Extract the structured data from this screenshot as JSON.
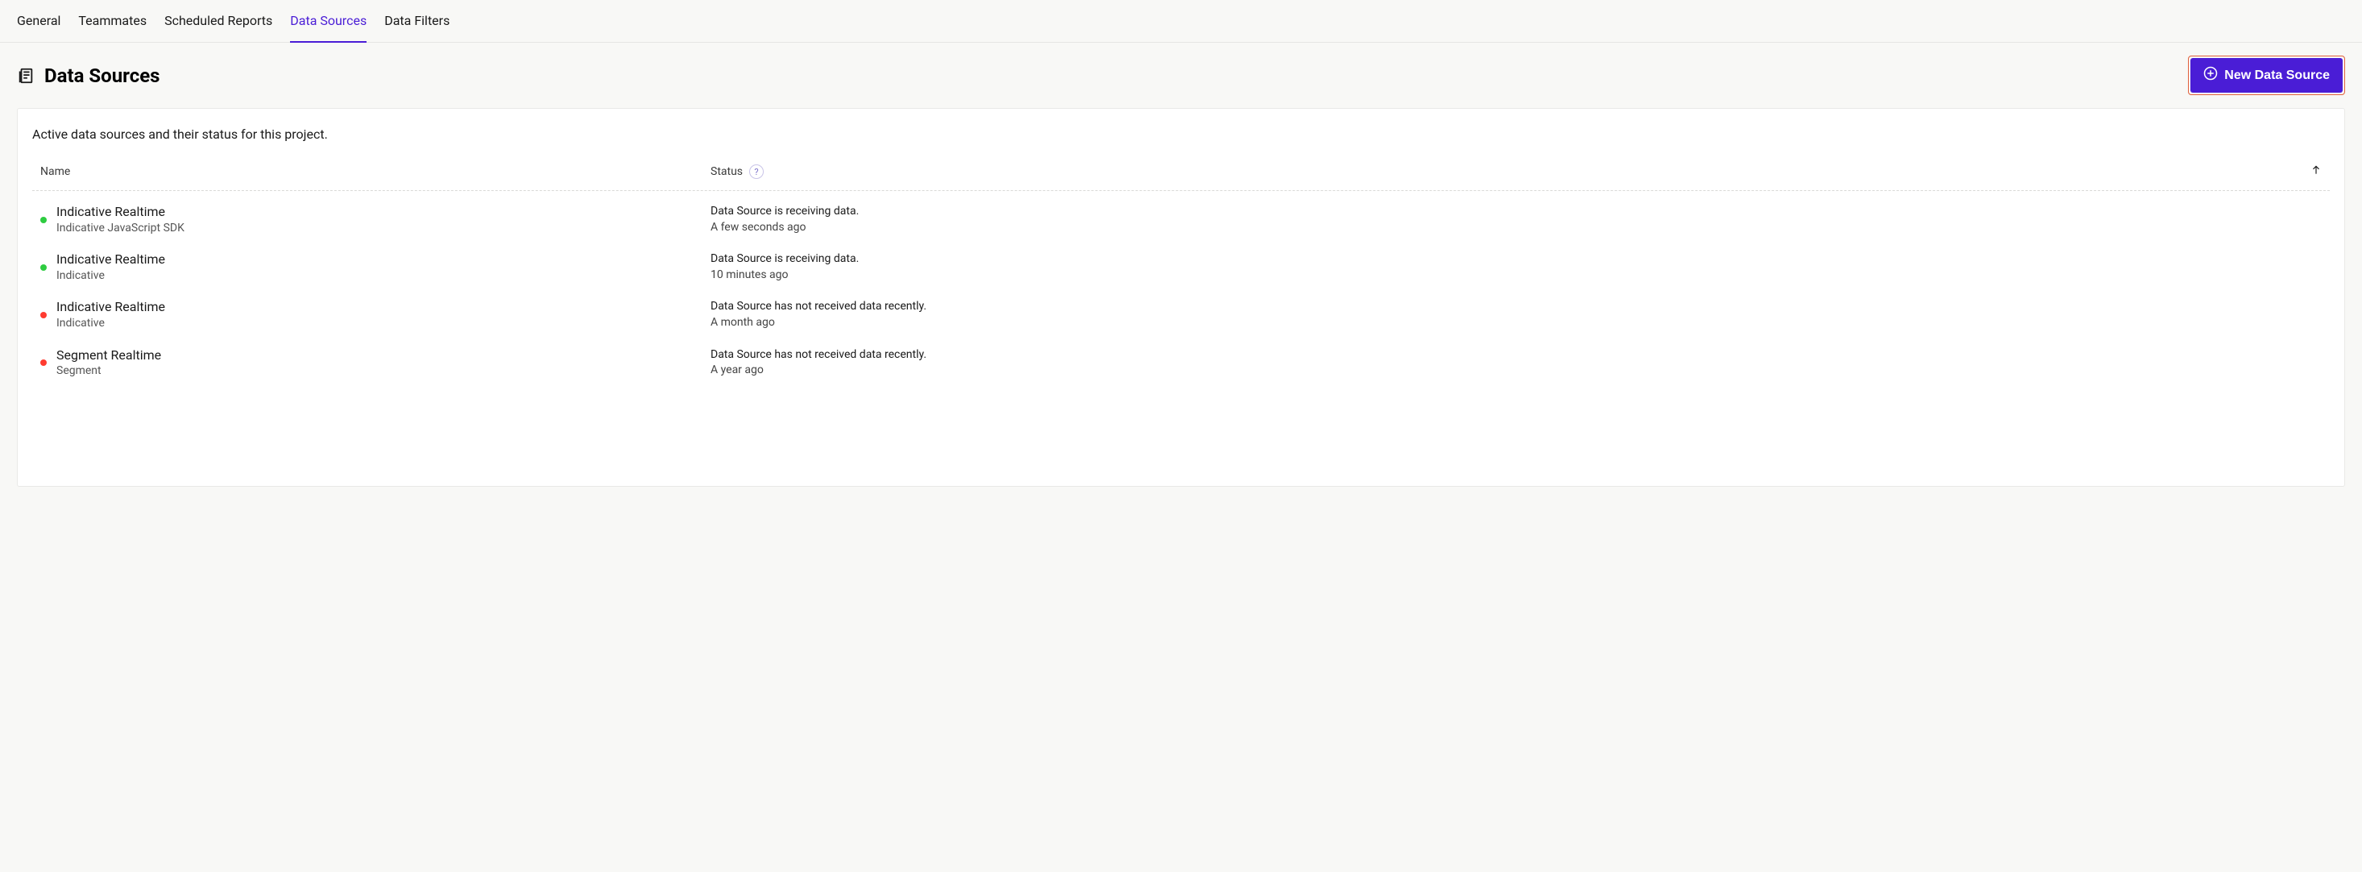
{
  "tabs": [
    {
      "label": "General",
      "active": false
    },
    {
      "label": "Teammates",
      "active": false
    },
    {
      "label": "Scheduled Reports",
      "active": false
    },
    {
      "label": "Data Sources",
      "active": true
    },
    {
      "label": "Data Filters",
      "active": false
    }
  ],
  "header": {
    "title": "Data Sources",
    "new_button": "New Data Source"
  },
  "panel": {
    "description": "Active data sources and their status for this project."
  },
  "columns": {
    "name": "Name",
    "status": "Status"
  },
  "rows": [
    {
      "status_color": "green",
      "name": "Indicative Realtime",
      "subtype": "Indicative JavaScript SDK",
      "status_text": "Data Source is receiving data.",
      "time": "A few seconds ago"
    },
    {
      "status_color": "green",
      "name": "Indicative Realtime",
      "subtype": "Indicative",
      "status_text": "Data Source is receiving data.",
      "time": "10 minutes ago"
    },
    {
      "status_color": "red",
      "name": "Indicative Realtime",
      "subtype": "Indicative",
      "status_text": "Data Source has not received data recently.",
      "time": "A month ago"
    },
    {
      "status_color": "red",
      "name": "Segment Realtime",
      "subtype": "Segment",
      "status_text": "Data Source has not received data recently.",
      "time": "A year ago"
    }
  ]
}
